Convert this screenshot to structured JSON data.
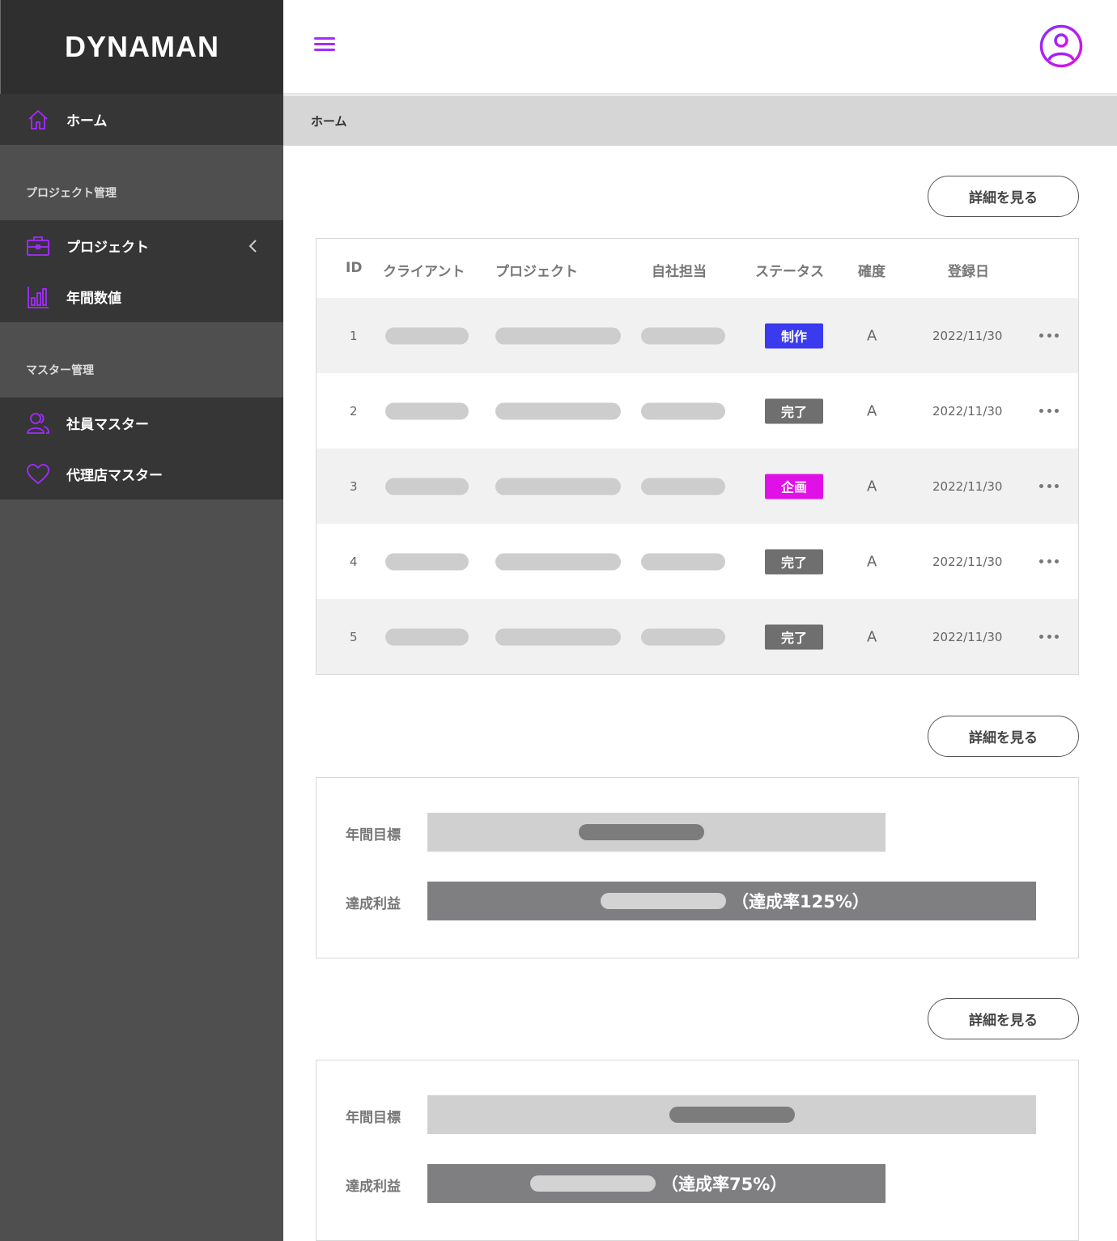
{
  "app": {
    "logo": "DYNAMAN"
  },
  "colors": {
    "accent": "#a52bff",
    "status_production": "#3a3aef",
    "status_planning": "#e011e6",
    "status_done": "#6f6f6f"
  },
  "sidebar": {
    "home": {
      "label": "ホーム",
      "icon": "home-icon"
    },
    "section_project": "プロジェクト管理",
    "project_items": [
      {
        "label": "プロジェクト",
        "icon": "briefcase-icon"
      },
      {
        "label": "年間数値",
        "icon": "bar-chart-icon"
      }
    ],
    "section_master": "マスター管理",
    "master_items": [
      {
        "label": "社員マスター",
        "icon": "users-icon"
      },
      {
        "label": "代理店マスター",
        "icon": "heart-icon"
      }
    ]
  },
  "header": {
    "menu_icon": "menu-icon",
    "avatar_icon": "user-circle-icon"
  },
  "breadcrumb": "ホーム",
  "main": {
    "detail_label": "詳細を見る",
    "table": {
      "headers": [
        "ID",
        "クライアント",
        "プロジェクト",
        "自社担当",
        "ステータス",
        "確度",
        "登録日"
      ],
      "rows": [
        {
          "id": "1",
          "status": "制作",
          "status_type": "production",
          "grade": "A",
          "date": "2022/11/30"
        },
        {
          "id": "2",
          "status": "完了",
          "status_type": "done",
          "grade": "A",
          "date": "2022/11/30"
        },
        {
          "id": "3",
          "status": "企画",
          "status_type": "planning",
          "grade": "A",
          "date": "2022/11/30"
        },
        {
          "id": "4",
          "status": "完了",
          "status_type": "done",
          "grade": "A",
          "date": "2022/11/30"
        },
        {
          "id": "5",
          "status": "完了",
          "status_type": "done",
          "grade": "A",
          "date": "2022/11/30"
        }
      ]
    },
    "summary_1": {
      "target_label": "年間目標",
      "profit_label": "達成利益",
      "rate_text": "（達成率125%）",
      "achievement_percent": 125
    },
    "summary_2": {
      "target_label": "年間目標",
      "profit_label": "達成利益",
      "rate_text": "（達成率75%）",
      "achievement_percent": 75
    }
  }
}
